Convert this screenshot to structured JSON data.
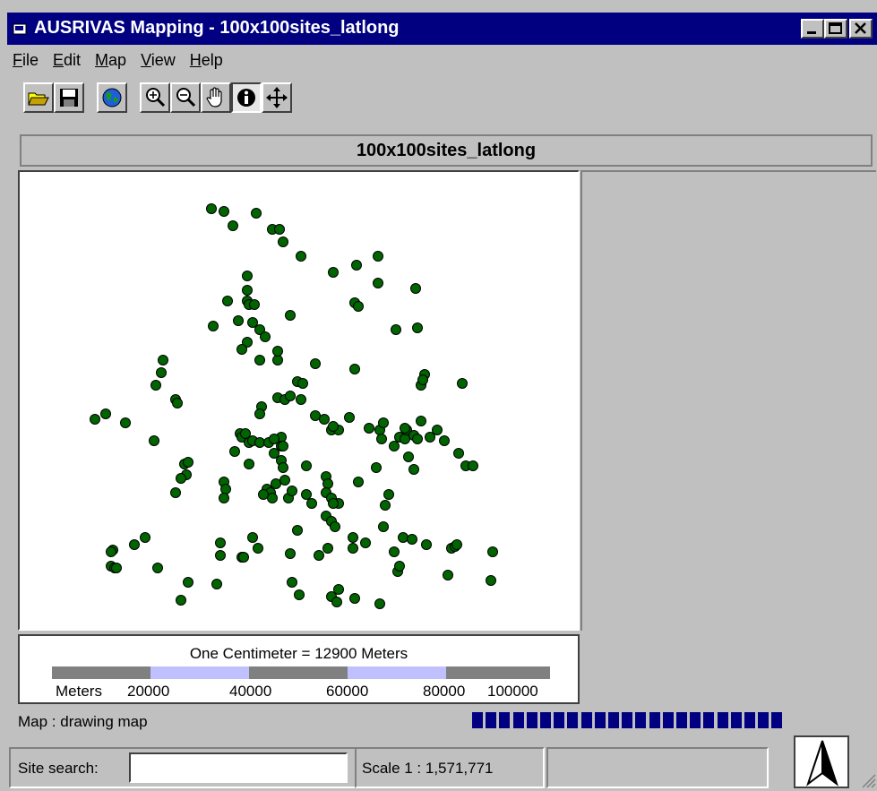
{
  "window": {
    "title": "AUSRIVAS Mapping - 100x100sites_latlong",
    "controls": [
      "minimize",
      "maximize",
      "close"
    ]
  },
  "menu": [
    {
      "label": "File",
      "accel": "F",
      "rest": "ile"
    },
    {
      "label": "Edit",
      "accel": "E",
      "rest": "dit"
    },
    {
      "label": "Map",
      "accel": "M",
      "rest": "ap"
    },
    {
      "label": "View",
      "accel": "V",
      "rest": "iew"
    },
    {
      "label": "Help",
      "accel": "H",
      "rest": "elp"
    }
  ],
  "toolbar": {
    "buttons": [
      "open-folder-icon",
      "save-disk-icon",
      "globe-icon",
      "zoom-in-icon",
      "zoom-out-icon",
      "pan-hand-icon",
      "info-icon",
      "move-icon"
    ],
    "active": "info-icon"
  },
  "layer_title": "100x100sites_latlong",
  "map": {
    "point_color": "#006400",
    "sites_note": "site markers"
  },
  "scale": {
    "caption": "One Centimeter = 12900 Meters",
    "unit_label": "Meters",
    "ticks": [
      "20000",
      "40000",
      "60000",
      "80000",
      "100000"
    ],
    "colors": [
      "#808080",
      "#c0c0ff"
    ]
  },
  "status": {
    "message": "Map : drawing map",
    "search_label": "Site search:",
    "search_value": "",
    "scale_text": "Scale 1 : 1,571,771",
    "progress_color": "#000080"
  }
}
